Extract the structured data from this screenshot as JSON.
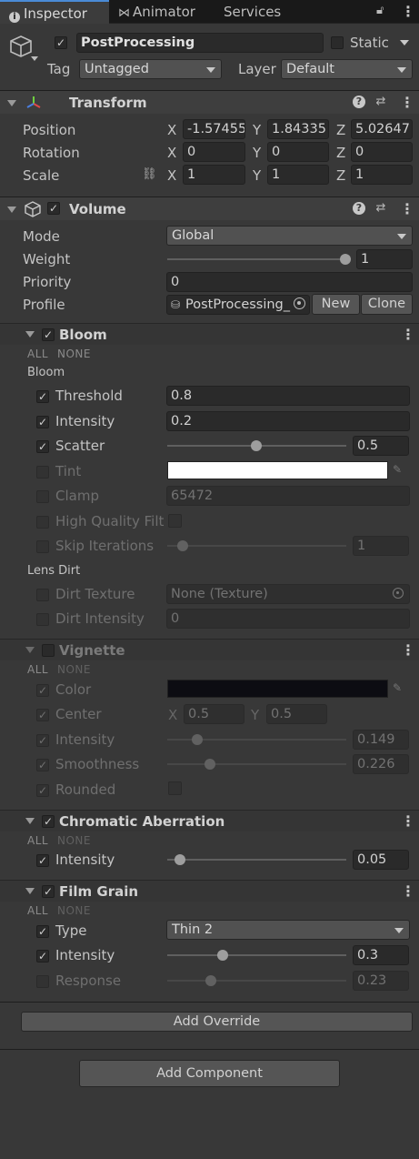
{
  "tabs": {
    "inspector": "Inspector",
    "animator": "Animator",
    "services": "Services"
  },
  "object": {
    "name": "PostProcessing",
    "static_label": "Static",
    "tag_label": "Tag",
    "tag_value": "Untagged",
    "layer_label": "Layer",
    "layer_value": "Default"
  },
  "transform": {
    "title": "Transform",
    "position_label": "Position",
    "rotation_label": "Rotation",
    "scale_label": "Scale",
    "axis_x": "X",
    "axis_y": "Y",
    "axis_z": "Z",
    "position": {
      "x": "-1.57455",
      "y": "1.84335",
      "z": "5.02647"
    },
    "rotation": {
      "x": "0",
      "y": "0",
      "z": "0"
    },
    "scale": {
      "x": "1",
      "y": "1",
      "z": "1"
    }
  },
  "volume": {
    "title": "Volume",
    "mode_label": "Mode",
    "mode_value": "Global",
    "weight_label": "Weight",
    "weight_value": "1",
    "priority_label": "Priority",
    "priority_value": "0",
    "profile_label": "Profile",
    "profile_value": "PostProcessing_",
    "new_label": "New",
    "clone_label": "Clone"
  },
  "all_label": "ALL",
  "none_label": "NONE",
  "bloom": {
    "title": "Bloom",
    "section_bloom": "Bloom",
    "section_lens": "Lens Dirt",
    "threshold_label": "Threshold",
    "threshold_value": "0.8",
    "intensity_label": "Intensity",
    "intensity_value": "0.2",
    "scatter_label": "Scatter",
    "scatter_value": "0.5",
    "scatter_fraction": 0.5,
    "tint_label": "Tint",
    "tint_color": "#ffffff",
    "clamp_label": "Clamp",
    "clamp_value": "65472",
    "hq_label": "High Quality Filte",
    "skip_label": "Skip Iterations",
    "skip_value": "1",
    "dirt_texture_label": "Dirt Texture",
    "dirt_texture_value": "None (Texture)",
    "dirt_intensity_label": "Dirt Intensity",
    "dirt_intensity_value": "0"
  },
  "vignette": {
    "title": "Vignette",
    "color_label": "Color",
    "color_value": "#0c0c12",
    "center_label": "Center",
    "center_x": "0.5",
    "center_y": "0.5",
    "intensity_label": "Intensity",
    "intensity_value": "0.149",
    "smoothness_label": "Smoothness",
    "smoothness_value": "0.226",
    "rounded_label": "Rounded"
  },
  "chromatic": {
    "title": "Chromatic Aberration",
    "intensity_label": "Intensity",
    "intensity_value": "0.05"
  },
  "filmgrain": {
    "title": "Film Grain",
    "type_label": "Type",
    "type_value": "Thin 2",
    "intensity_label": "Intensity",
    "intensity_value": "0.3",
    "response_label": "Response",
    "response_value": "0.23"
  },
  "add_override": "Add Override",
  "add_component": "Add Component",
  "colors": {
    "tab_accent": "#4a8bd6",
    "background": "#383838"
  }
}
